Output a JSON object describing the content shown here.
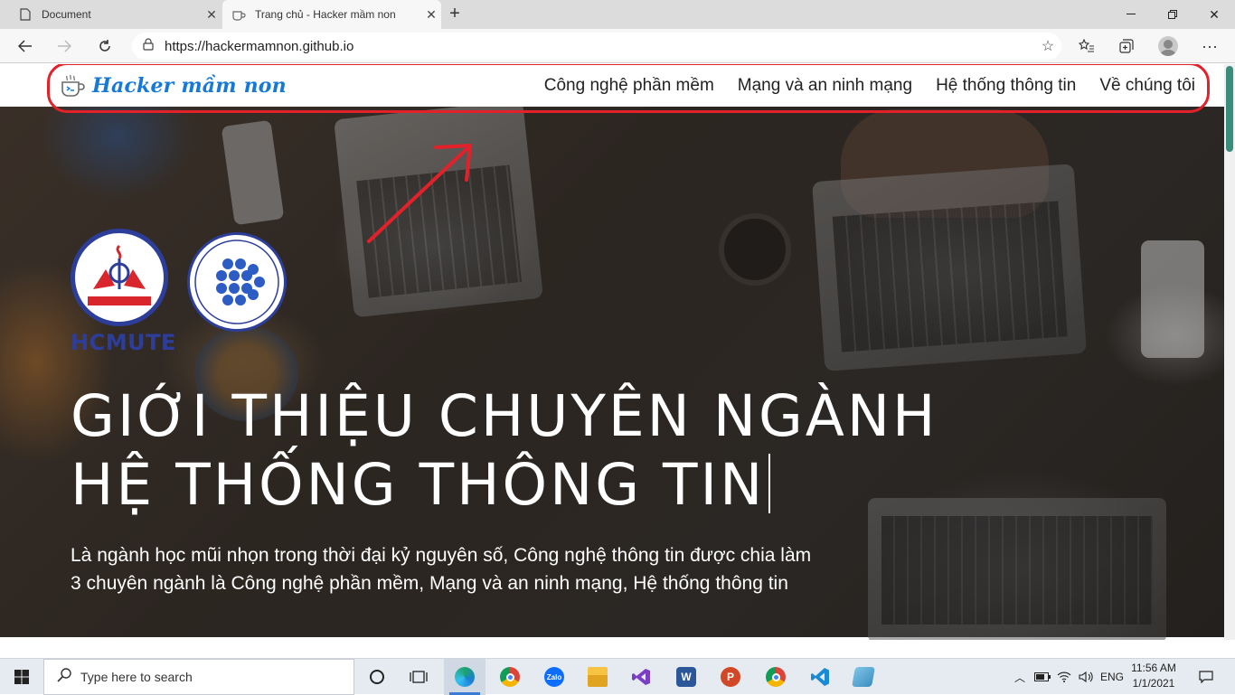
{
  "browser": {
    "tabs": [
      {
        "title": "Document",
        "active": false
      },
      {
        "title": "Trang chủ - Hacker mầm non",
        "active": true
      }
    ],
    "address": "https://hackermamnon.github.io",
    "icons": {
      "back": "back-arrow-icon",
      "forward": "forward-arrow-icon",
      "refresh": "refresh-icon",
      "lock": "lock-icon",
      "star": "star-icon",
      "favorites": "favorites-icon",
      "collections": "collections-icon",
      "profile": "profile-avatar",
      "more": "more-icon"
    }
  },
  "site": {
    "brand": "Hacker mầm non",
    "menu": [
      {
        "label": "Công nghệ phần mềm"
      },
      {
        "label": "Mạng và an ninh mạng"
      },
      {
        "label": "Hệ thống thông tin"
      },
      {
        "label": "Về chúng tôi"
      }
    ],
    "logo_school": "HCMUTE",
    "hero_title_line1": "GIỚI THIỆU CHUYÊN NGÀNH",
    "hero_title_line2": "HỆ THỐNG THÔNG TIN",
    "hero_subtitle_line1": "Là ngành học mũi nhọn trong thời đại kỷ nguyên số, Công nghệ thông tin được chia làm",
    "hero_subtitle_line2": "3 chuyên ngành là Công nghệ phần mềm, Mạng và an ninh mạng, Hệ thống thông tin",
    "annotation_color": "#e3212a",
    "brand_color": "#1779d6"
  },
  "taskbar": {
    "search_placeholder": "Type here to search",
    "apps": [
      "task-view",
      "edge",
      "chrome",
      "zalo",
      "file-explorer",
      "visual-studio",
      "word",
      "powerpoint",
      "chrome-alt",
      "vscode",
      "notepad"
    ],
    "language": "ENG",
    "time": "11:56 AM",
    "date": "1/1/2021"
  }
}
